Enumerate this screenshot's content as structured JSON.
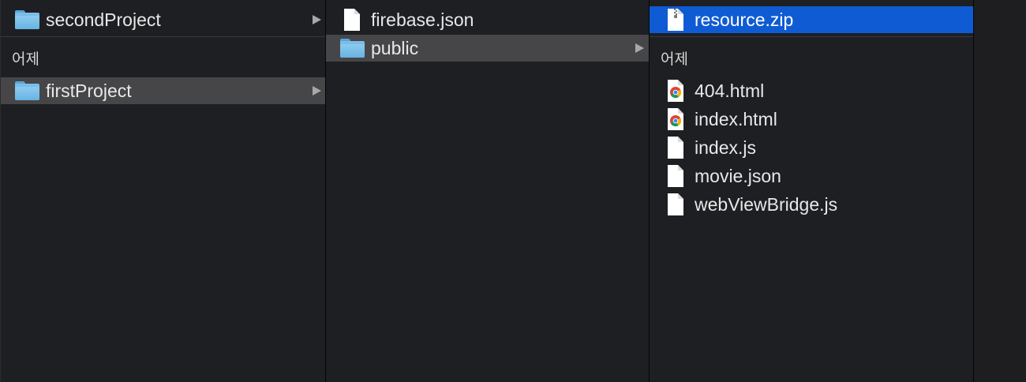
{
  "columns": [
    {
      "id": "col1",
      "rows": [
        {
          "label": "secondProject",
          "icon": "folder-icon",
          "has_arrow": true,
          "selected": "none"
        }
      ],
      "group_header": "어제",
      "rows_after_header": [
        {
          "label": "firstProject",
          "icon": "folder-icon",
          "has_arrow": true,
          "selected": "gray"
        }
      ]
    },
    {
      "id": "col2",
      "rows": [
        {
          "label": "firebase.json",
          "icon": "document-icon",
          "has_arrow": false,
          "selected": "none"
        },
        {
          "label": "public",
          "icon": "folder-icon",
          "has_arrow": true,
          "selected": "gray"
        }
      ]
    },
    {
      "id": "col3",
      "rows": [
        {
          "label": "resource.zip",
          "icon": "zip-archive-icon",
          "has_arrow": false,
          "selected": "blue"
        }
      ],
      "group_header": "어제",
      "rows_after_header": [
        {
          "label": "404.html",
          "icon": "chrome-html-icon",
          "has_arrow": false,
          "selected": "none"
        },
        {
          "label": "index.html",
          "icon": "chrome-html-icon",
          "has_arrow": false,
          "selected": "none"
        },
        {
          "label": "index.js",
          "icon": "document-icon",
          "has_arrow": false,
          "selected": "none"
        },
        {
          "label": "movie.json",
          "icon": "document-icon",
          "has_arrow": false,
          "selected": "none"
        },
        {
          "label": "webViewBridge.js",
          "icon": "document-icon",
          "has_arrow": false,
          "selected": "none"
        }
      ]
    }
  ],
  "colors": {
    "background": "#1e1f22",
    "selection_gray": "#464649",
    "selection_blue": "#0f5bd3",
    "folder_blue": "#6ab3e2"
  }
}
